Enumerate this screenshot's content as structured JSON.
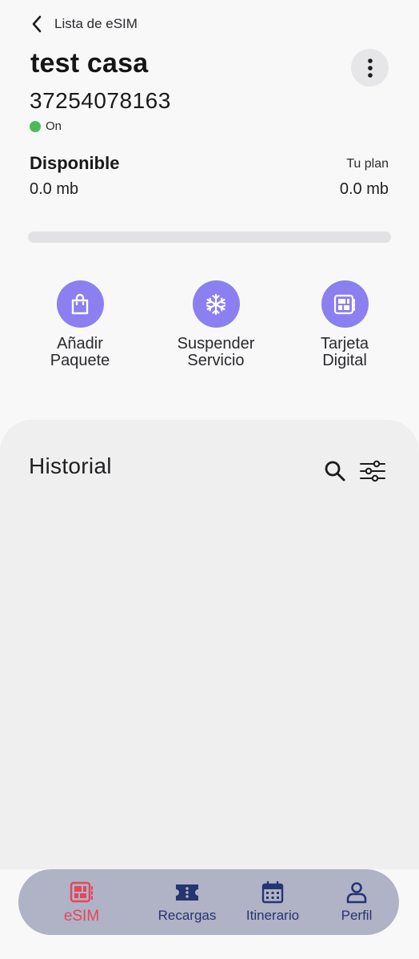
{
  "header": {
    "back_label": "Lista de eSIM",
    "title": "test casa",
    "phone_number": "37254078163",
    "status_text": "On"
  },
  "balance": {
    "available_label": "Disponible",
    "available_value": "0.0 mb",
    "plan_label": "Tu plan",
    "plan_value": "0.0 mb",
    "usage_fraction": 0
  },
  "actions": [
    {
      "line1": "Añadir",
      "line2": "Paquete",
      "icon": "bag-icon"
    },
    {
      "line1": "Suspender",
      "line2": "Servicio",
      "icon": "snowflake-icon"
    },
    {
      "line1": "Tarjeta",
      "line2": "Digital",
      "icon": "sim-card-icon"
    }
  ],
  "history": {
    "title": "Historial"
  },
  "nav": {
    "items": [
      {
        "label": "eSIM",
        "icon": "sim-card-icon",
        "active": true
      },
      {
        "label": "Recargas",
        "icon": "ticket-icon",
        "active": false
      },
      {
        "label": "Itinerario",
        "icon": "calendar-icon",
        "active": false
      },
      {
        "label": "Perfil",
        "icon": "user-icon",
        "active": false
      }
    ]
  },
  "colors": {
    "accent": "#8c7ff0",
    "status_on": "#4cba5b",
    "nav_active": "#e4465c",
    "nav_inactive": "#263470",
    "nav_background": "#b0b2c5"
  }
}
